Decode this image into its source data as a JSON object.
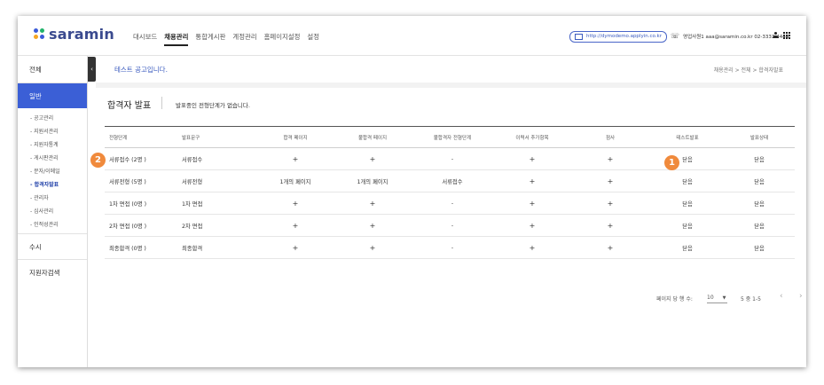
{
  "logo": {
    "text": "saramin",
    "dot_colors": [
      "#3b5bd9",
      "#21b36b",
      "#f5a623",
      "#3b5bd9"
    ]
  },
  "nav": [
    "대시보드",
    "채용관리",
    "통합게시판",
    "계정관리",
    "홈페이지설정",
    "설정"
  ],
  "nav_active": "채용관리",
  "url": "http://dymodemo.applyin.co.kr",
  "contact": "영업사원1 aaa@saramin.co.kr 02-3333-4444",
  "sidebar": {
    "total": "전체",
    "active": "일반",
    "subs": [
      "공고관리",
      "지원서관리",
      "지원자통계",
      "게시판관리",
      "문자/이메일",
      "합격자발표",
      "관리자",
      "심사관리",
      "인적성관리"
    ],
    "bold_sub": "합격자발표",
    "susi": "수시",
    "search": "지원자검색",
    "collapse": "‹"
  },
  "notice": "테스트 공고입니다.",
  "breadcrumb": "채용관리 > 전체 > 합격자발표",
  "panel": {
    "title": "합격자 발표",
    "desc": "발표중인 전형단계가 없습니다."
  },
  "table": {
    "headers": [
      "전형단계",
      "발표문구",
      "합격 페이지",
      "불합격 페이지",
      "불합격자 전형단계",
      "이력서 추가항목",
      "점사",
      "테스트발표",
      "발표상태"
    ],
    "rows": [
      [
        "서류접수 (2명 )",
        "서류접수",
        "+",
        "+",
        "-",
        "+",
        "+",
        "닫음",
        "닫음"
      ],
      [
        "서류전형 (5명 )",
        "서류전형",
        "1개의 페이지",
        "1개의 페이지",
        "서류접수",
        "+",
        "+",
        "닫음",
        "닫음"
      ],
      [
        "1차 면접 (0명 )",
        "1차 면접",
        "+",
        "+",
        "-",
        "+",
        "+",
        "닫음",
        "닫음"
      ],
      [
        "2차 면접 (0명 )",
        "2차 면접",
        "+",
        "+",
        "-",
        "+",
        "+",
        "닫음",
        "닫음"
      ],
      [
        "최종합격 (0명 )",
        "최종합격",
        "+",
        "+",
        "-",
        "+",
        "+",
        "닫음",
        "닫음"
      ]
    ]
  },
  "pager": {
    "per_page_label": "페이지 당 행 수:",
    "per_page": "10",
    "range": "5 중 1-5",
    "prev": "‹",
    "next": "›"
  },
  "badges": [
    "1",
    "2"
  ],
  "accent": "#3b5fd6",
  "badge_color": "#f08a3c"
}
